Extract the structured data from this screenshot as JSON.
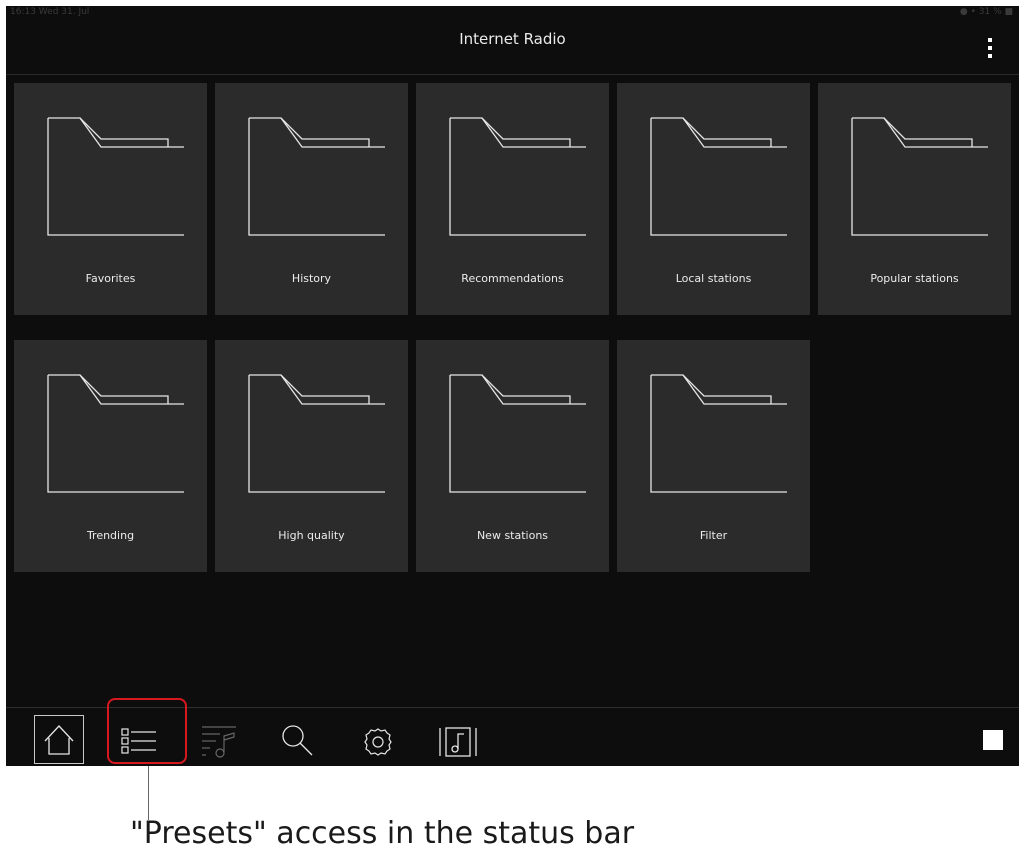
{
  "status_bar": {
    "time_date": "16:13  Wed 31. Jul",
    "indicators": "● • 31 % ■"
  },
  "app_bar": {
    "title": "Internet Radio",
    "menu_icon": "more-vertical-icon"
  },
  "tiles": [
    {
      "label": "Favorites",
      "icon": "folder-icon"
    },
    {
      "label": "History",
      "icon": "folder-icon"
    },
    {
      "label": "Recommendations",
      "icon": "folder-icon"
    },
    {
      "label": "Local stations",
      "icon": "folder-icon"
    },
    {
      "label": "Popular stations",
      "icon": "folder-icon"
    },
    {
      "label": "Trending",
      "icon": "folder-icon"
    },
    {
      "label": "High quality",
      "icon": "folder-icon"
    },
    {
      "label": "New stations",
      "icon": "folder-icon"
    },
    {
      "label": "Filter",
      "icon": "folder-icon"
    }
  ],
  "bottom_bar": {
    "items": [
      "home-icon",
      "presets-icon",
      "queue-icon",
      "search-icon",
      "settings-icon",
      "now-playing-icon"
    ],
    "stop_icon": "stop-icon",
    "active": "home-icon"
  },
  "annotation": {
    "caption": "\"Presets\" access in the status bar",
    "highlight_color": "#d7191f"
  },
  "colors": {
    "background": "#0d0d0d",
    "tile": "#2b2b2b",
    "text": "#eaeaea"
  }
}
